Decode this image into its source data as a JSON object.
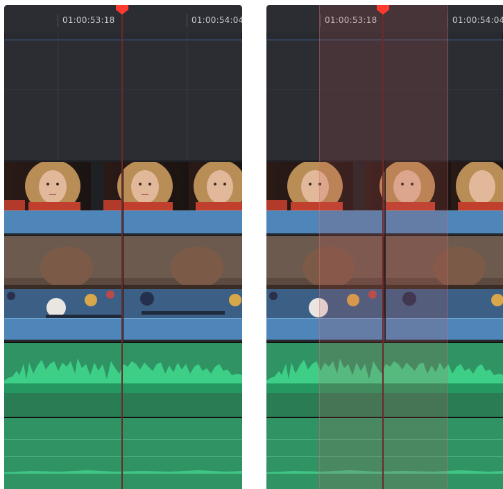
{
  "panels": [
    {
      "id": "left",
      "timecodes": [
        "01:00:53:18",
        "01:00:54:04"
      ],
      "range_selection": false
    },
    {
      "id": "right",
      "timecodes": [
        "01:00:53:18",
        "01:00:54:04"
      ],
      "range_selection": true
    }
  ],
  "tracks": {
    "video_1": "portrait clip",
    "video_2": "pool table clip",
    "audio_1": "waveform",
    "audio_2": "waveform"
  },
  "colors": {
    "video_clip": "#4f86b9",
    "audio_clip": "#2f9364",
    "playhead": "#ff3b30",
    "selection": "#c85a5a"
  }
}
